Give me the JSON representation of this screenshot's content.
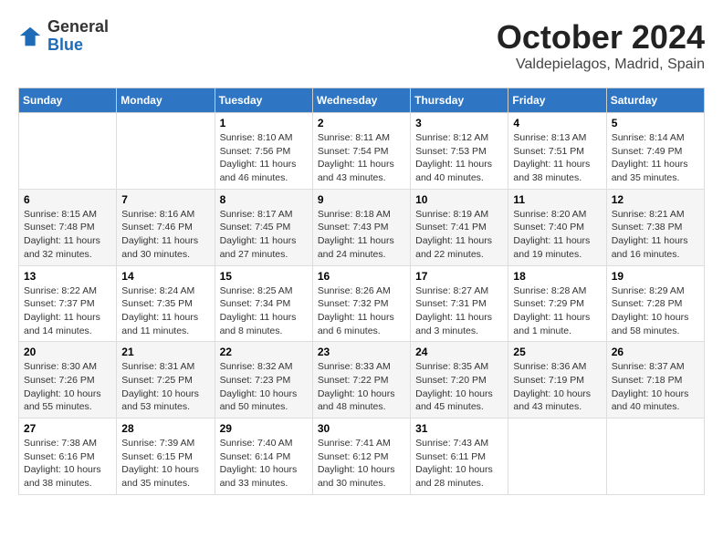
{
  "header": {
    "logo_line1": "General",
    "logo_line2": "Blue",
    "month": "October 2024",
    "location": "Valdepielagos, Madrid, Spain"
  },
  "weekdays": [
    "Sunday",
    "Monday",
    "Tuesday",
    "Wednesday",
    "Thursday",
    "Friday",
    "Saturday"
  ],
  "weeks": [
    [
      {
        "day": "",
        "detail": ""
      },
      {
        "day": "",
        "detail": ""
      },
      {
        "day": "1",
        "detail": "Sunrise: 8:10 AM\nSunset: 7:56 PM\nDaylight: 11 hours and 46 minutes."
      },
      {
        "day": "2",
        "detail": "Sunrise: 8:11 AM\nSunset: 7:54 PM\nDaylight: 11 hours and 43 minutes."
      },
      {
        "day": "3",
        "detail": "Sunrise: 8:12 AM\nSunset: 7:53 PM\nDaylight: 11 hours and 40 minutes."
      },
      {
        "day": "4",
        "detail": "Sunrise: 8:13 AM\nSunset: 7:51 PM\nDaylight: 11 hours and 38 minutes."
      },
      {
        "day": "5",
        "detail": "Sunrise: 8:14 AM\nSunset: 7:49 PM\nDaylight: 11 hours and 35 minutes."
      }
    ],
    [
      {
        "day": "6",
        "detail": "Sunrise: 8:15 AM\nSunset: 7:48 PM\nDaylight: 11 hours and 32 minutes."
      },
      {
        "day": "7",
        "detail": "Sunrise: 8:16 AM\nSunset: 7:46 PM\nDaylight: 11 hours and 30 minutes."
      },
      {
        "day": "8",
        "detail": "Sunrise: 8:17 AM\nSunset: 7:45 PM\nDaylight: 11 hours and 27 minutes."
      },
      {
        "day": "9",
        "detail": "Sunrise: 8:18 AM\nSunset: 7:43 PM\nDaylight: 11 hours and 24 minutes."
      },
      {
        "day": "10",
        "detail": "Sunrise: 8:19 AM\nSunset: 7:41 PM\nDaylight: 11 hours and 22 minutes."
      },
      {
        "day": "11",
        "detail": "Sunrise: 8:20 AM\nSunset: 7:40 PM\nDaylight: 11 hours and 19 minutes."
      },
      {
        "day": "12",
        "detail": "Sunrise: 8:21 AM\nSunset: 7:38 PM\nDaylight: 11 hours and 16 minutes."
      }
    ],
    [
      {
        "day": "13",
        "detail": "Sunrise: 8:22 AM\nSunset: 7:37 PM\nDaylight: 11 hours and 14 minutes."
      },
      {
        "day": "14",
        "detail": "Sunrise: 8:24 AM\nSunset: 7:35 PM\nDaylight: 11 hours and 11 minutes."
      },
      {
        "day": "15",
        "detail": "Sunrise: 8:25 AM\nSunset: 7:34 PM\nDaylight: 11 hours and 8 minutes."
      },
      {
        "day": "16",
        "detail": "Sunrise: 8:26 AM\nSunset: 7:32 PM\nDaylight: 11 hours and 6 minutes."
      },
      {
        "day": "17",
        "detail": "Sunrise: 8:27 AM\nSunset: 7:31 PM\nDaylight: 11 hours and 3 minutes."
      },
      {
        "day": "18",
        "detail": "Sunrise: 8:28 AM\nSunset: 7:29 PM\nDaylight: 11 hours and 1 minute."
      },
      {
        "day": "19",
        "detail": "Sunrise: 8:29 AM\nSunset: 7:28 PM\nDaylight: 10 hours and 58 minutes."
      }
    ],
    [
      {
        "day": "20",
        "detail": "Sunrise: 8:30 AM\nSunset: 7:26 PM\nDaylight: 10 hours and 55 minutes."
      },
      {
        "day": "21",
        "detail": "Sunrise: 8:31 AM\nSunset: 7:25 PM\nDaylight: 10 hours and 53 minutes."
      },
      {
        "day": "22",
        "detail": "Sunrise: 8:32 AM\nSunset: 7:23 PM\nDaylight: 10 hours and 50 minutes."
      },
      {
        "day": "23",
        "detail": "Sunrise: 8:33 AM\nSunset: 7:22 PM\nDaylight: 10 hours and 48 minutes."
      },
      {
        "day": "24",
        "detail": "Sunrise: 8:35 AM\nSunset: 7:20 PM\nDaylight: 10 hours and 45 minutes."
      },
      {
        "day": "25",
        "detail": "Sunrise: 8:36 AM\nSunset: 7:19 PM\nDaylight: 10 hours and 43 minutes."
      },
      {
        "day": "26",
        "detail": "Sunrise: 8:37 AM\nSunset: 7:18 PM\nDaylight: 10 hours and 40 minutes."
      }
    ],
    [
      {
        "day": "27",
        "detail": "Sunrise: 7:38 AM\nSunset: 6:16 PM\nDaylight: 10 hours and 38 minutes."
      },
      {
        "day": "28",
        "detail": "Sunrise: 7:39 AM\nSunset: 6:15 PM\nDaylight: 10 hours and 35 minutes."
      },
      {
        "day": "29",
        "detail": "Sunrise: 7:40 AM\nSunset: 6:14 PM\nDaylight: 10 hours and 33 minutes."
      },
      {
        "day": "30",
        "detail": "Sunrise: 7:41 AM\nSunset: 6:12 PM\nDaylight: 10 hours and 30 minutes."
      },
      {
        "day": "31",
        "detail": "Sunrise: 7:43 AM\nSunset: 6:11 PM\nDaylight: 10 hours and 28 minutes."
      },
      {
        "day": "",
        "detail": ""
      },
      {
        "day": "",
        "detail": ""
      }
    ]
  ]
}
